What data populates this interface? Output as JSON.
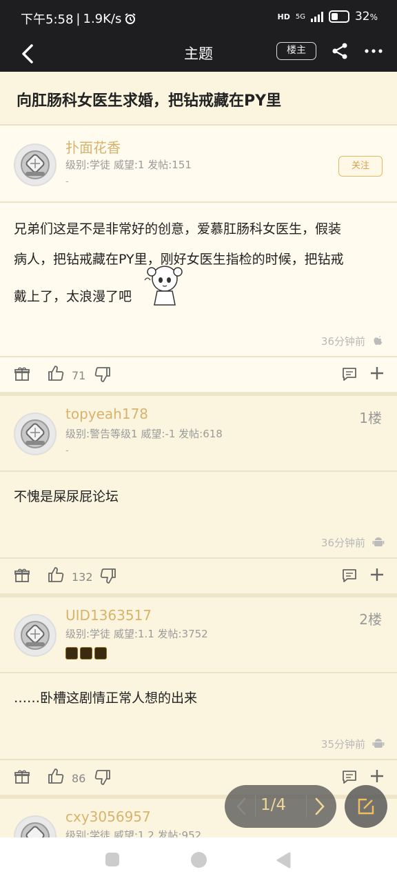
{
  "status": {
    "time": "下午5:58",
    "speed": "1.9K/s",
    "network": "5G",
    "hd": "HD",
    "battery": "32"
  },
  "nav": {
    "title": "主题",
    "owner_label": "楼主"
  },
  "topic": {
    "title": "向肛肠科女医生求婚，把钻戒藏在PY里"
  },
  "posts": [
    {
      "username": "扑面花香",
      "meta": "级别:学徒 威望:1 发帖:151",
      "dash": "-",
      "follow": "关注",
      "content_lines": [
        "兄弟们这是不是非常好的创意，爱慕肛肠科女医生，假装",
        "病人，把钻戒藏在PY里，刚好女医生指检的时候，把钻戒",
        "戴上了，太浪漫了吧"
      ],
      "time": "36分钟前",
      "platform_icon": "apple-icon",
      "likes": "71"
    },
    {
      "username": "topyeah178",
      "meta": "级别:警告等级1 威望:-1 发帖:618",
      "dash": "-",
      "floor": "1楼",
      "content": "不愧是屎尿屁论坛",
      "time": "36分钟前",
      "platform_icon": "android-icon",
      "likes": "132"
    },
    {
      "username": "UID1363517",
      "meta": "级别:学徒 威望:1.1 发帖:3752",
      "floor": "2楼",
      "content": "……卧槽这剧情正常人想的出来",
      "time": "35分钟前",
      "platform_icon": "android-icon",
      "likes": "86"
    },
    {
      "username": "cxy3056957",
      "meta": "级别:学徒 威望:1.2 发帖:952"
    }
  ],
  "pager": {
    "text": "1/4"
  },
  "colors": {
    "bar": "#1e1e20",
    "page_bg": "#fbf5df",
    "accent": "#d8b36c"
  }
}
